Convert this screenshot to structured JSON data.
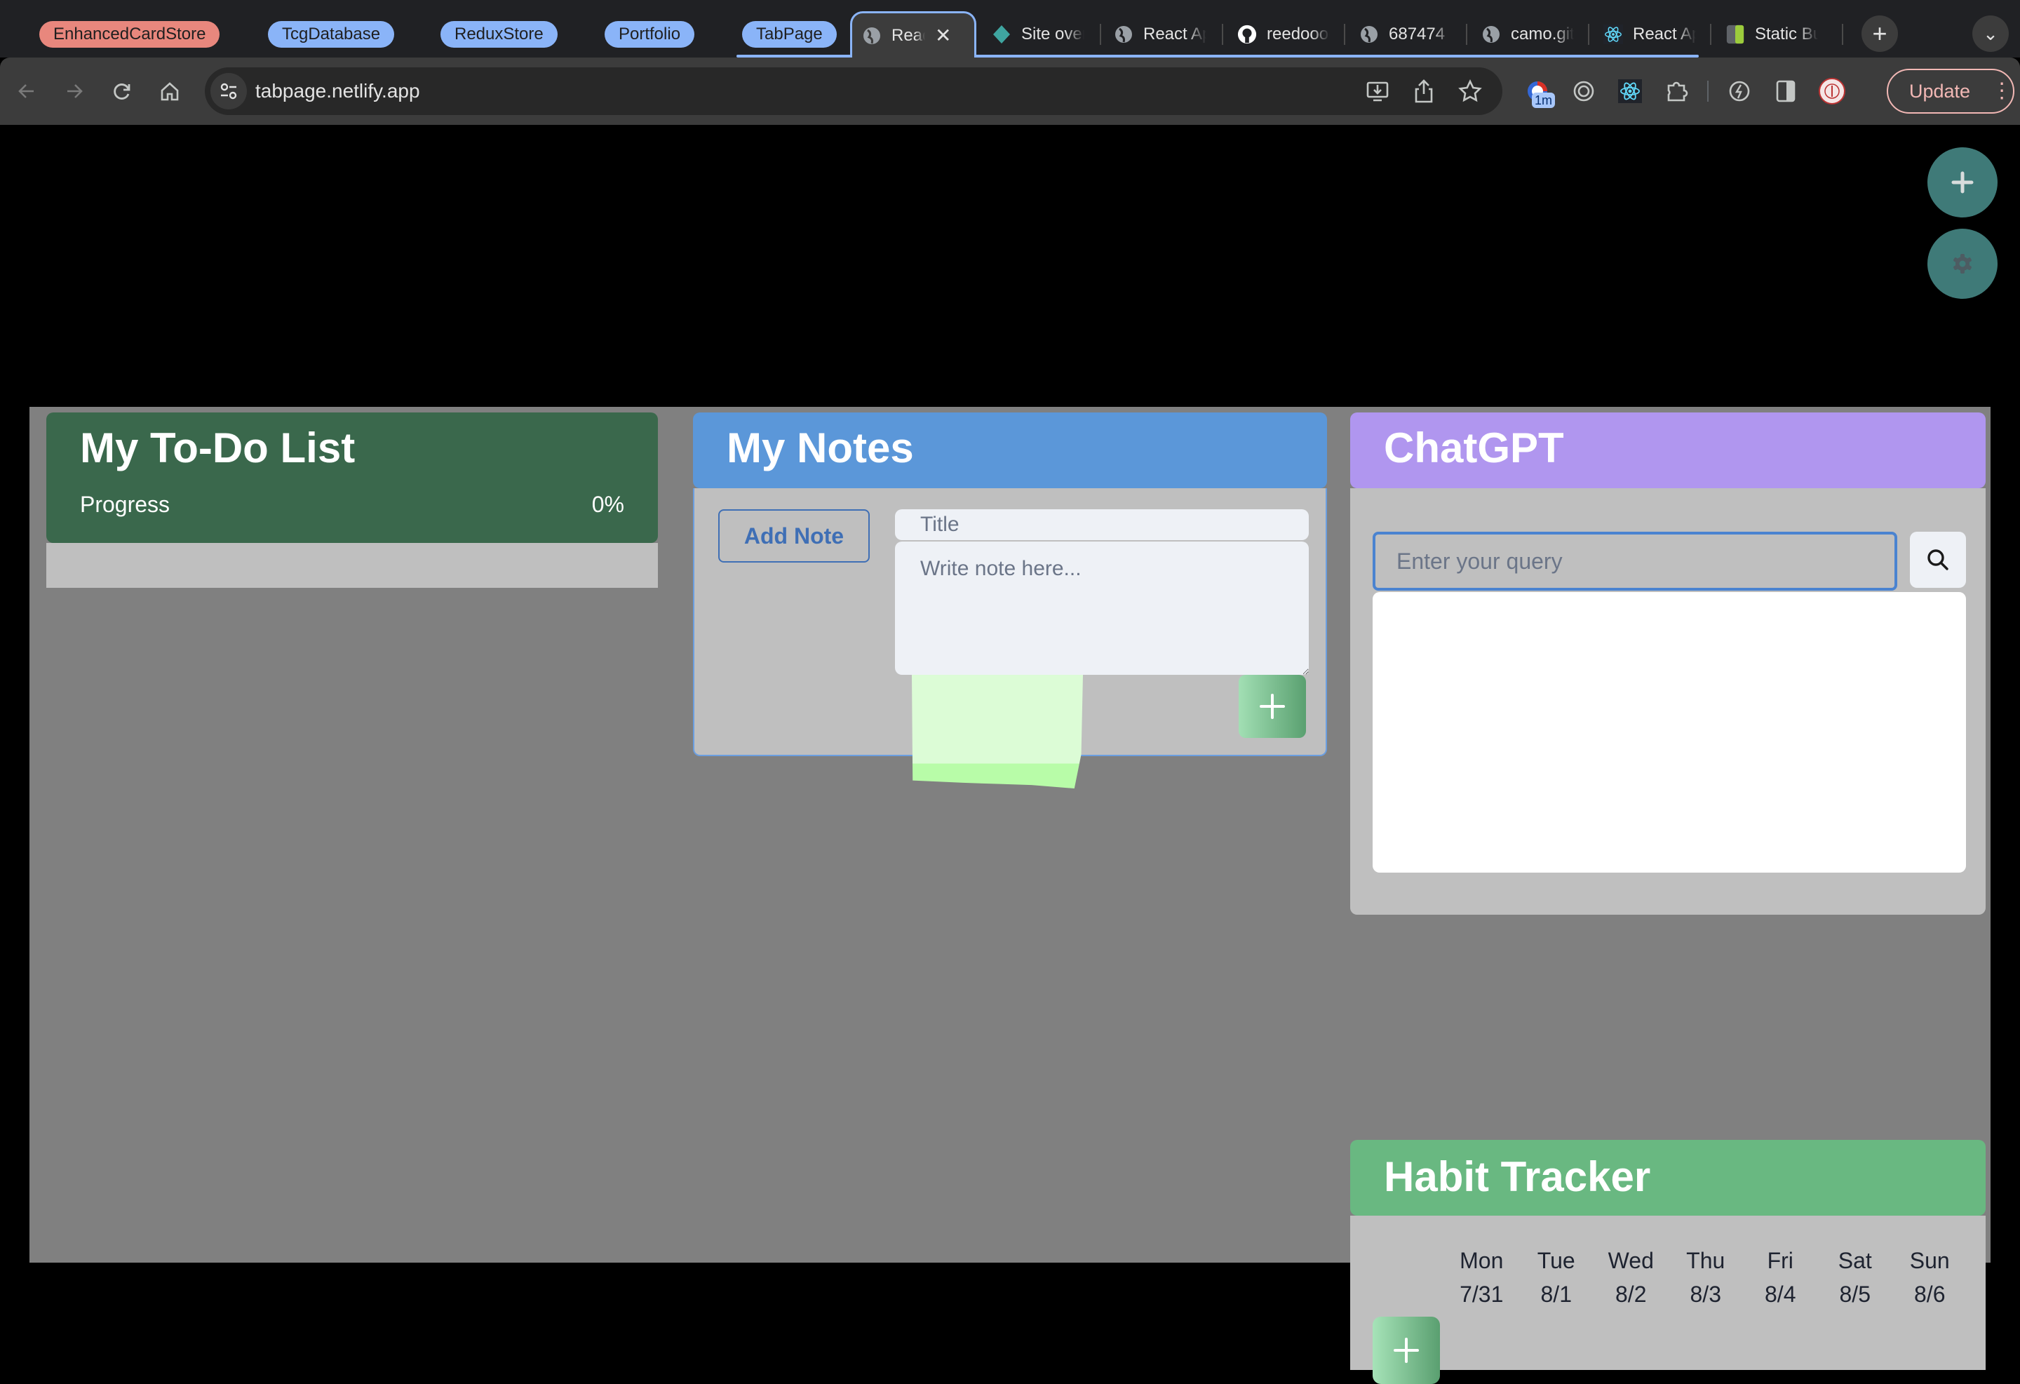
{
  "browser": {
    "tab_groups": [
      {
        "label": "EnhancedCardStore",
        "color": "#e8877d"
      },
      {
        "label": "TcgDatabase",
        "color": "#8ab4f8"
      },
      {
        "label": "ReduxStore",
        "color": "#8ab4f8"
      },
      {
        "label": "Portfolio",
        "color": "#8ab4f8"
      },
      {
        "label": "TabPage",
        "color": "#8ab4f8"
      }
    ],
    "tabs": [
      {
        "title": "React App",
        "icon": "globe-icon",
        "active": true
      },
      {
        "title": "Site overview",
        "icon": "netlify-icon"
      },
      {
        "title": "React App",
        "icon": "globe-icon"
      },
      {
        "title": "reedoooo",
        "icon": "github-icon"
      },
      {
        "title": "687474",
        "icon": "globe-icon"
      },
      {
        "title": "camo.githubusercontent",
        "icon": "globe-icon"
      },
      {
        "title": "React App",
        "icon": "react-icon"
      },
      {
        "title": "Static Build",
        "icon": "static-icon"
      }
    ],
    "url": "tabpage.netlify.app",
    "extension_badge": "1m",
    "update_label": "Update"
  },
  "fabs": {
    "add_icon": "plus-icon",
    "settings_icon": "gear-icon"
  },
  "todo": {
    "title": "My To-Do List",
    "progress_label": "Progress",
    "progress_value": "0%",
    "header_color": "#3a684c"
  },
  "notes": {
    "title": "My Notes",
    "add_note_label": "Add Note",
    "title_placeholder": "Title",
    "body_placeholder": "Write note here...",
    "header_color": "#5b97d9"
  },
  "chatgpt": {
    "title": "ChatGPT",
    "query_placeholder": "Enter your query",
    "header_color": "#b096ef"
  },
  "habit_tracker": {
    "title": "Habit Tracker",
    "header_color": "#69b881",
    "days": [
      {
        "name": "Mon",
        "date": "7/31"
      },
      {
        "name": "Tue",
        "date": "8/1"
      },
      {
        "name": "Wed",
        "date": "8/2"
      },
      {
        "name": "Thu",
        "date": "8/3"
      },
      {
        "name": "Fri",
        "date": "8/4"
      },
      {
        "name": "Sat",
        "date": "8/5"
      },
      {
        "name": "Sun",
        "date": "8/6"
      }
    ]
  }
}
